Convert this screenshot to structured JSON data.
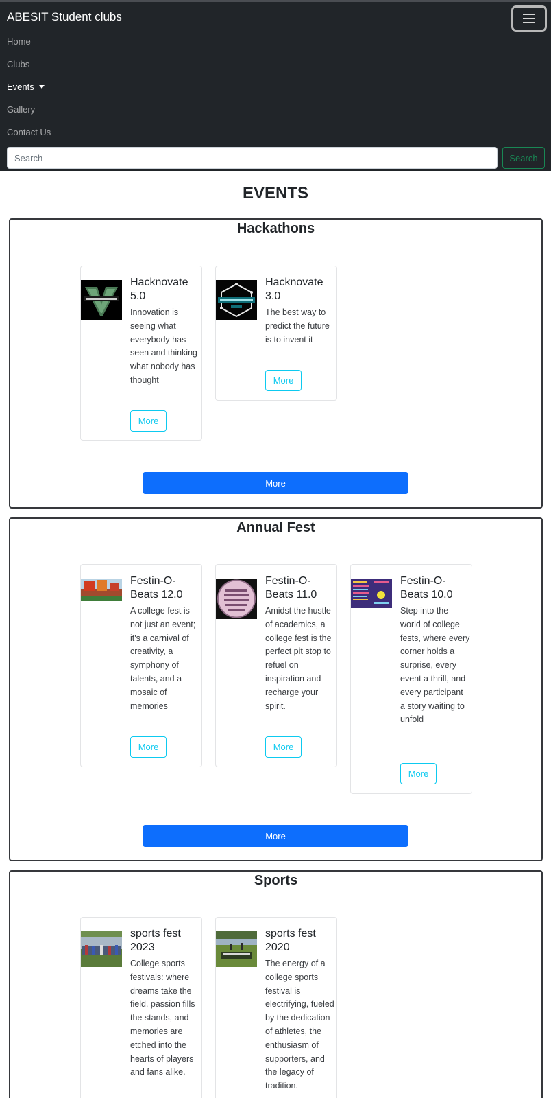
{
  "navbar": {
    "brand": "ABESIT Student clubs",
    "links": [
      "Home",
      "Clubs",
      "Events",
      "Gallery",
      "Contact Us"
    ],
    "search_placeholder": "Search",
    "search_button": "Search"
  },
  "page_title": "EVENTS",
  "sections": [
    {
      "title": "Hackathons",
      "more_label": "More",
      "cards": [
        {
          "title": "Hacknovate 5.0",
          "text": "Innovation is seeing what everybody has seen and thinking what nobody has thought",
          "button": "More"
        },
        {
          "title": "Hacknovate 3.0",
          "text": "The best way to predict the future is to invent it",
          "button": "More"
        }
      ]
    },
    {
      "title": "Annual Fest",
      "more_label": "More",
      "cards": [
        {
          "title": "Festin-O-Beats 12.0",
          "text": "A college fest is not just an event; it's a carnival of creativity, a symphony of talents, and a mosaic of memories",
          "button": "More"
        },
        {
          "title": "Festin-O-Beats 11.0",
          "text": "Amidst the hustle of academics, a college fest is the perfect pit stop to refuel on inspiration and recharge your spirit.",
          "button": "More"
        },
        {
          "title": "Festin-O-Beats 10.0",
          "text": "Step into the world of college fests, where every corner holds a surprise, every event a thrill, and every participant a story waiting to unfold",
          "button": "More"
        }
      ]
    },
    {
      "title": "Sports",
      "cards": [
        {
          "title": "sports fest 2023",
          "text": "College sports festivals: where dreams take the field, passion fills the stands, and memories are etched into the hearts of players and fans alike."
        },
        {
          "title": "sports fest 2020",
          "text": "The energy of a college sports festival is electrifying, fueled by the dedication of athletes, the enthusiasm of supporters, and the legacy of tradition."
        }
      ]
    }
  ]
}
